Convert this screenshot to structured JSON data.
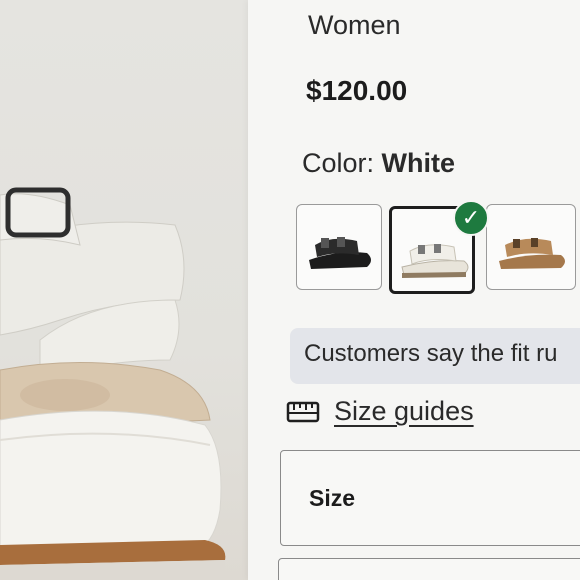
{
  "product": {
    "category": "Women",
    "price": "$120.00",
    "color_label": "Color:",
    "color_value": "White"
  },
  "swatches": [
    {
      "name": "black",
      "selected": false
    },
    {
      "name": "white",
      "selected": true
    },
    {
      "name": "tan",
      "selected": false
    }
  ],
  "fit_banner": {
    "text": "Customers say the fit ru"
  },
  "size_guides": {
    "label": "Size guides",
    "icon": "ruler-icon"
  },
  "size_selector": {
    "label": "Size"
  },
  "colors": {
    "selected_check": "#1e7a3f",
    "panel_bg": "#f6f6f4",
    "banner_bg": "#e3e5ea"
  }
}
